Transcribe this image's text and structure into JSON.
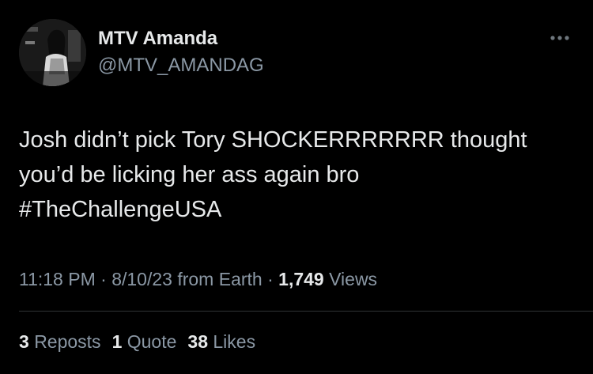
{
  "author": {
    "display_name": "MTV Amanda",
    "handle": "@MTV_AMANDAG"
  },
  "more_icon": "more-horizontal-icon",
  "tweet": {
    "lines": [
      "Josh didn’t pick Tory SHOCKERRRRRRR thought",
      "you’d be licking her ass again bro"
    ],
    "hashtag": "#TheChallengeUSA"
  },
  "meta": {
    "time": "11:18 PM",
    "sep1": "·",
    "date": "8/10/23",
    "source": "from Earth",
    "sep2": "·",
    "views_count": "1,749",
    "views_label": "Views"
  },
  "stats": {
    "reposts_count": "3",
    "reposts_label": "Reposts",
    "quotes_count": "1",
    "quotes_label": "Quote",
    "likes_count": "38",
    "likes_label": "Likes"
  },
  "colors": {
    "background": "#000000",
    "primary_text": "#e7e9ea",
    "secondary_text": "#8b98a5",
    "divider": "#2f3336"
  }
}
